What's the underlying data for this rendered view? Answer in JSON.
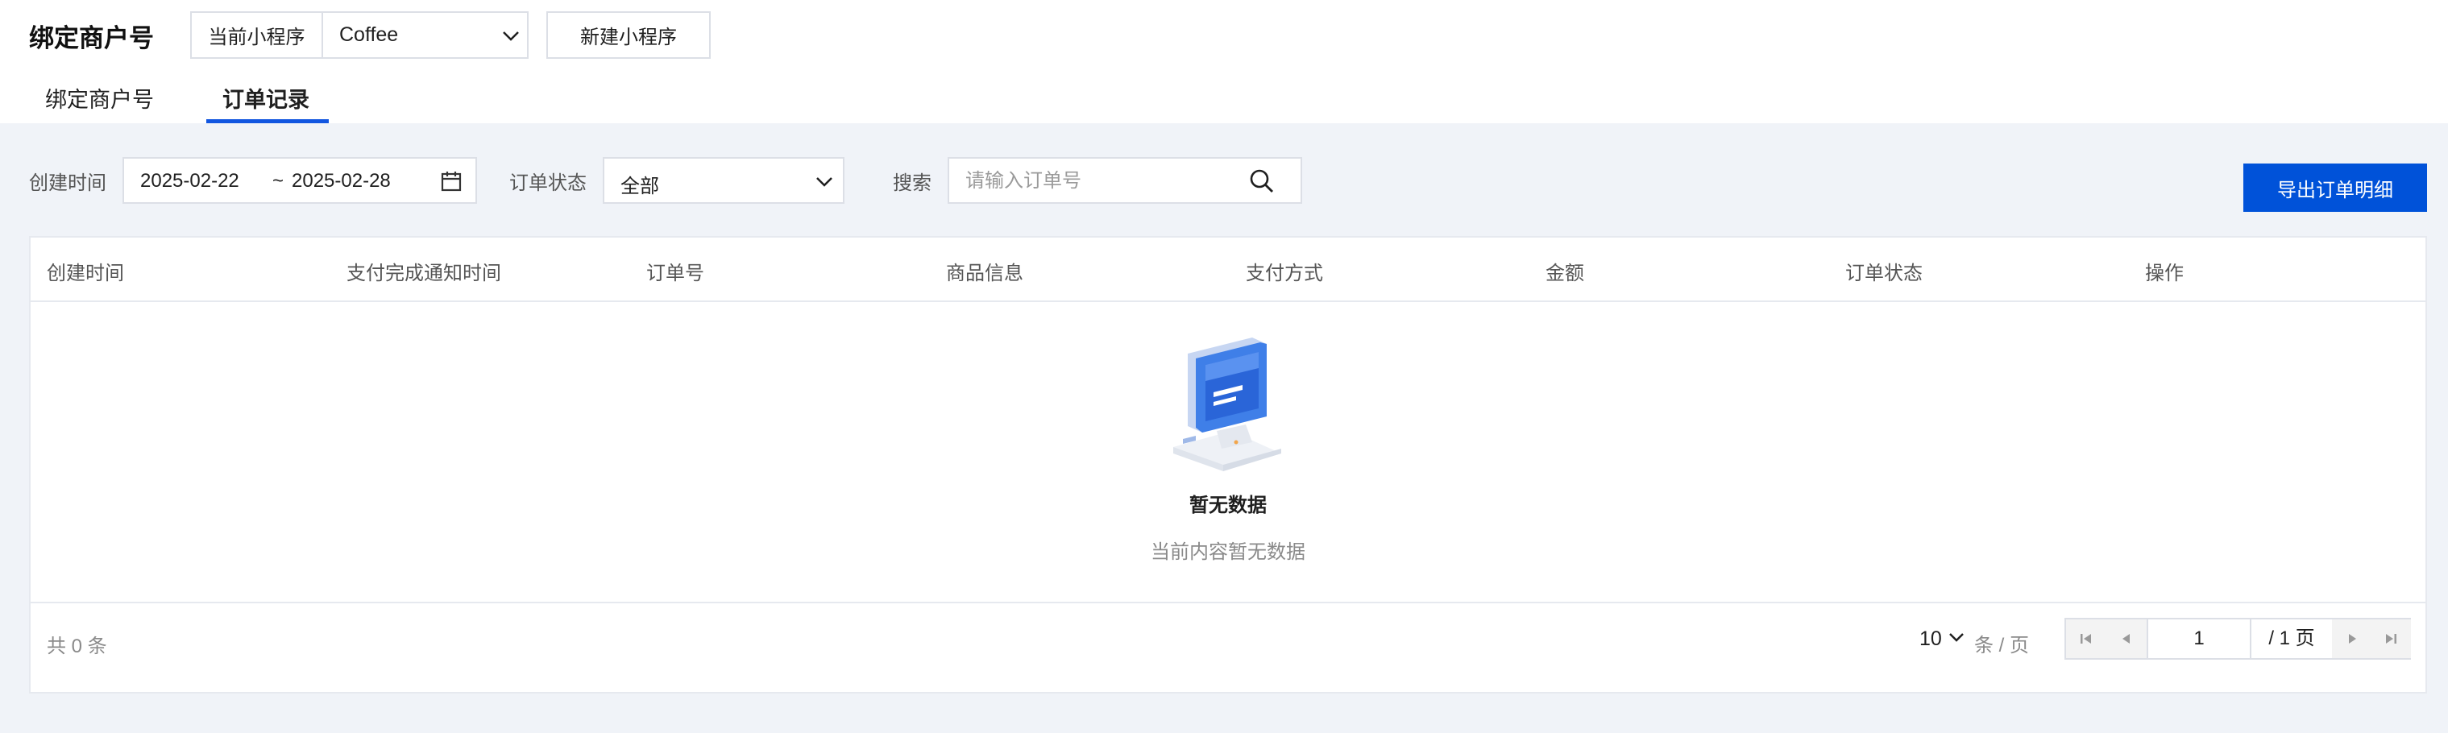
{
  "header": {
    "page_title": "绑定商户号",
    "app_select_label": "当前小程序",
    "app_select_value": "Coffee",
    "new_app_button": "新建小程序"
  },
  "tabs": [
    {
      "label": "绑定商户号",
      "active": false
    },
    {
      "label": "订单记录",
      "active": true
    }
  ],
  "filters": {
    "created_time_label": "创建时间",
    "date_start": "2025-02-22",
    "date_separator": "~",
    "date_end": "2025-02-28",
    "status_label": "订单状态",
    "status_value": "全部",
    "search_label": "搜索",
    "search_placeholder": "请输入订单号"
  },
  "export_button": "导出订单明细",
  "table": {
    "columns": [
      "创建时间",
      "支付完成通知时间",
      "订单号",
      "商品信息",
      "支付方式",
      "金额",
      "订单状态",
      "操作"
    ],
    "rows": []
  },
  "empty_state": {
    "title": "暂无数据",
    "description": "当前内容暂无数据"
  },
  "pagination": {
    "total_text": "共 0 条",
    "page_size": "10",
    "per_page_suffix": "条 / 页",
    "current_page": "1",
    "total_pages_text": "/ 1 页"
  },
  "colors": {
    "primary": "#0052d9",
    "page_background": "#f0f3f8"
  },
  "icons": [
    "chevron-down-icon",
    "calendar-icon",
    "search-icon",
    "first-page-icon",
    "prev-page-icon",
    "next-page-icon",
    "last-page-icon",
    "empty-computer-illustration"
  ]
}
